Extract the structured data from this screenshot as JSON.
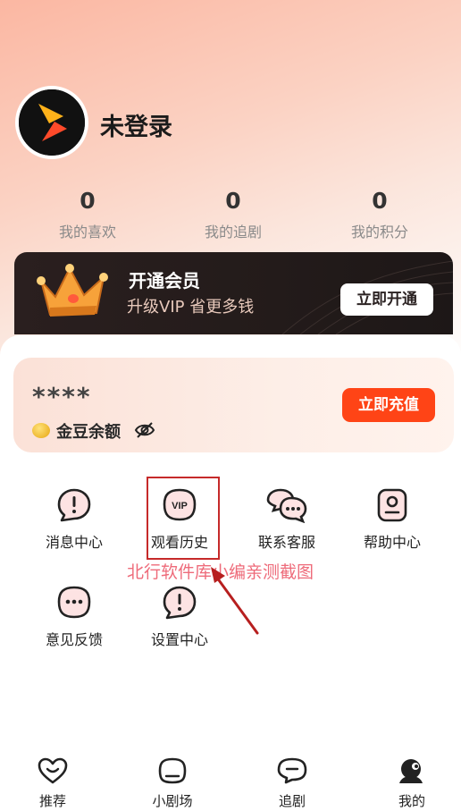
{
  "profile": {
    "name": "未登录"
  },
  "stats": [
    {
      "value": "0",
      "label": "我的喜欢"
    },
    {
      "value": "0",
      "label": "我的追剧"
    },
    {
      "value": "0",
      "label": "我的积分"
    }
  ],
  "vip": {
    "title": "开通会员",
    "subtitle": "升级VIP 省更多钱",
    "button": "立即开通"
  },
  "balance": {
    "masked": "****",
    "label": "金豆余额",
    "button": "立即充值"
  },
  "grid": [
    {
      "label": "消息中心",
      "icon": "message-icon"
    },
    {
      "label": "观看历史",
      "icon": "vip-history-icon"
    },
    {
      "label": "联系客服",
      "icon": "chat-icon"
    },
    {
      "label": "帮助中心",
      "icon": "help-icon"
    },
    {
      "label": "意见反馈",
      "icon": "feedback-icon"
    },
    {
      "label": "设置中心",
      "icon": "settings-icon"
    }
  ],
  "watermark": "北行软件库小编亲测截图",
  "tabs": [
    {
      "label": "推荐",
      "icon": "heart-face-icon"
    },
    {
      "label": "小剧场",
      "icon": "theater-icon"
    },
    {
      "label": "追剧",
      "icon": "drama-icon"
    },
    {
      "label": "我的",
      "icon": "profile-icon"
    }
  ],
  "colors": {
    "accent": "#ff4416",
    "vip_bg": "#231b1a",
    "highlight": "#c62a2a"
  }
}
